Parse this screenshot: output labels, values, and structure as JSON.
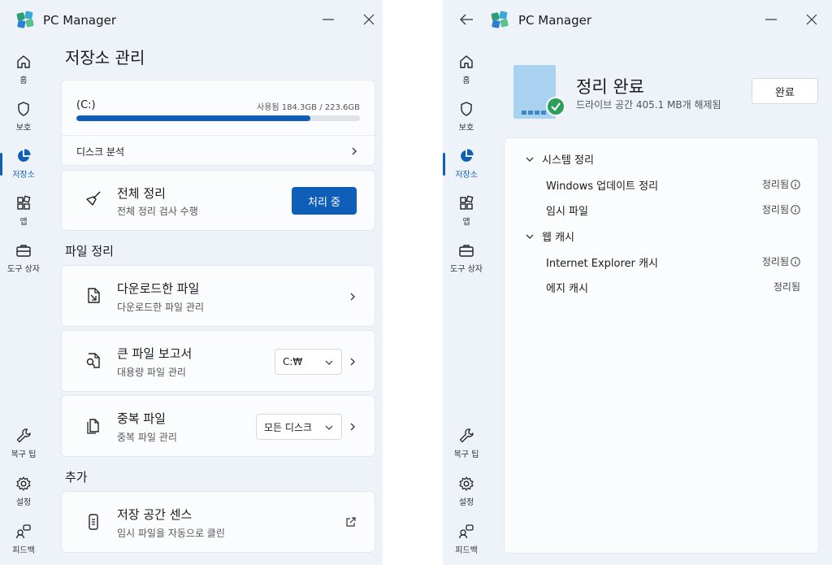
{
  "app": {
    "title": "PC Manager"
  },
  "nav": {
    "home": "홈",
    "protect": "보호",
    "storage": "저장소",
    "apps": "앱",
    "toolbox": "도구 상자",
    "repair": "복구 팁",
    "settings": "설정",
    "feedback": "피드백"
  },
  "storage_page": {
    "title": "저장소 관리",
    "drive": {
      "label": "(C:)",
      "usage_text": "사용됨 184.3GB / 223.6GB",
      "used_fraction": 0.824,
      "analysis_label": "디스크 분석"
    },
    "full_cleanup": {
      "title": "전체 정리",
      "subtitle": "전체 정리 검사 수행",
      "button": "처리 중"
    },
    "file_cleanup_heading": "파일 정리",
    "downloads": {
      "title": "다운로드한 파일",
      "subtitle": "다운로드한 파일 관리"
    },
    "large_files": {
      "title": "큰 파일 보고서",
      "subtitle": "대용량 파일 관리",
      "select_value": "C:₩"
    },
    "duplicates": {
      "title": "중복 파일",
      "subtitle": "중복 파일 관리",
      "select_value": "모든 디스크"
    },
    "more_heading": "추가",
    "storage_sense": {
      "title": "저장 공간 센스",
      "subtitle": "임시 파일을 자동으로 클린"
    }
  },
  "cleanup_done": {
    "title": "정리 완료",
    "subtitle": "드라이브 공간 405.1 MB개 해제됨",
    "done_button": "완료",
    "groups": [
      {
        "label": "시스템 정리",
        "items": [
          {
            "label": "Windows 업데이트 정리",
            "status": "정리됨",
            "info": true
          },
          {
            "label": "임시 파일",
            "status": "정리됨",
            "info": true
          }
        ]
      },
      {
        "label": "웹 캐시",
        "items": [
          {
            "label": "Internet Explorer 캐시",
            "status": "정리됨",
            "info": true
          },
          {
            "label": "에지 캐시",
            "status": "정리됨",
            "info": false
          }
        ]
      }
    ]
  },
  "colors": {
    "accent": "#0f5fb8",
    "success": "#2b9e5a",
    "window_bg": "#eef3fa"
  }
}
